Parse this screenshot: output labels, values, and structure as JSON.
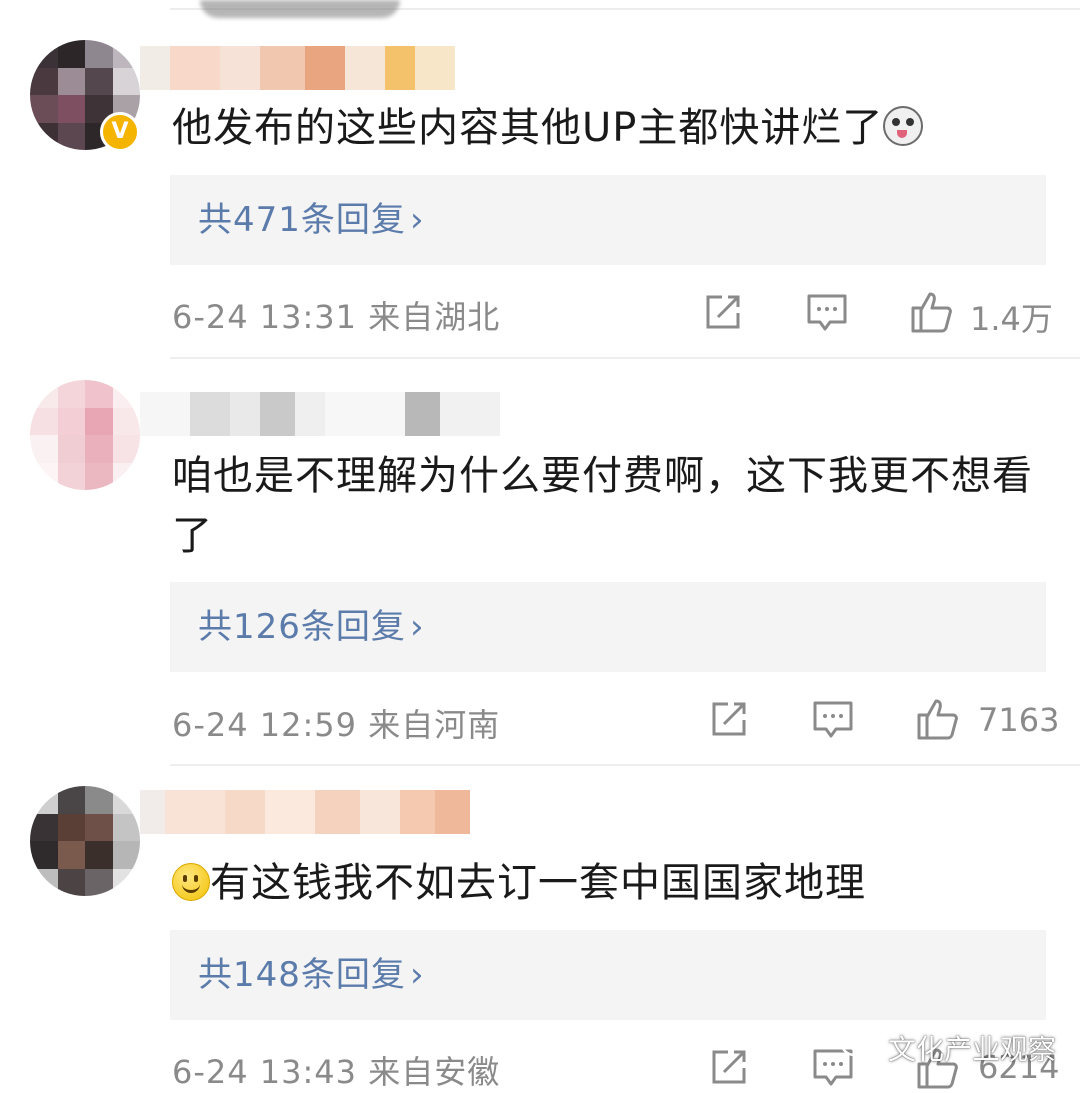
{
  "comments": [
    {
      "text": "他发布的这些内容其他UP主都快讲烂了",
      "emoji": "dog-face-emoji",
      "replies_label": "共471条回复",
      "meta": "6-24 13:31 来自湖北",
      "likes": "1.4万",
      "verified": true
    },
    {
      "text": "咱也是不理解为什么要付费啊，这下我更不想看了",
      "replies_label": "共126条回复",
      "meta": "6-24 12:59 来自河南",
      "likes": "7163",
      "verified": false
    },
    {
      "text": "有这钱我不如去订一套中国国家地理",
      "emoji": "smile-emoji",
      "replies_label": "共148条回复",
      "meta": "6-24 13:43 来自安徽",
      "likes": "6214",
      "verified": false
    }
  ],
  "watermark": {
    "text": "文化产业观察",
    "icon": "wechat-icon"
  },
  "colors": {
    "link": "#5b7bab",
    "meta": "#8a8a8a",
    "reply_bg": "#f4f4f4",
    "verified": "#f4b400"
  }
}
